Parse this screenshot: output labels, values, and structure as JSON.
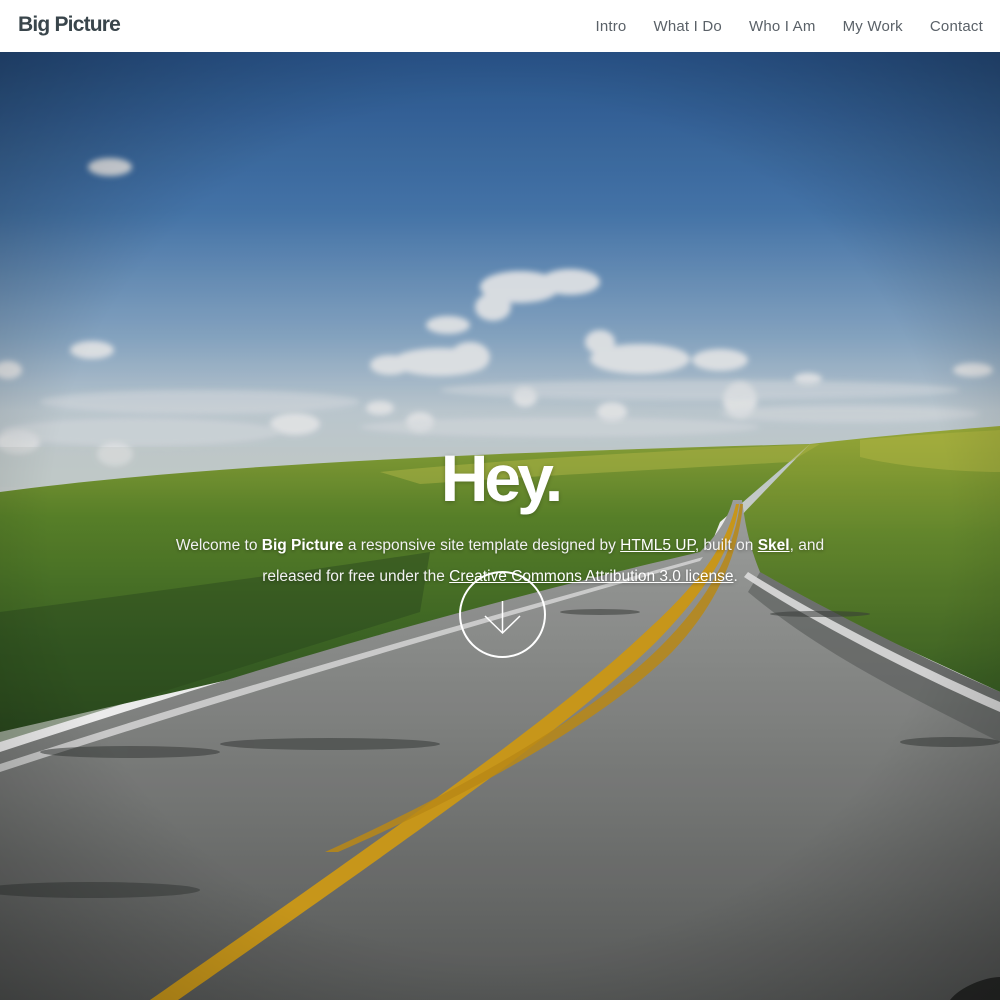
{
  "header": {
    "logo": "Big Picture",
    "nav": [
      {
        "label": "Intro"
      },
      {
        "label": "What I Do"
      },
      {
        "label": "Who I Am"
      },
      {
        "label": "My Work"
      },
      {
        "label": "Contact"
      }
    ]
  },
  "intro": {
    "heading": "Hey.",
    "text_1": "Welcome to ",
    "brand": "Big Picture",
    "text_2": " a responsive site template designed by ",
    "link_html5up": "HTML5 UP",
    "text_3": ", built on ",
    "link_skel": "Skel",
    "text_4": ", and released for free under the ",
    "link_license": "Creative Commons Attribution 3.0 license",
    "text_5": "."
  },
  "icons": {
    "scroll_down": "arrow-down-icon"
  },
  "colors": {
    "header_bg": "#ffffff",
    "logo": "#39454b",
    "nav_text": "#5a6168",
    "sky_top": "#2f5e98",
    "road_line": "#d9a51f"
  }
}
